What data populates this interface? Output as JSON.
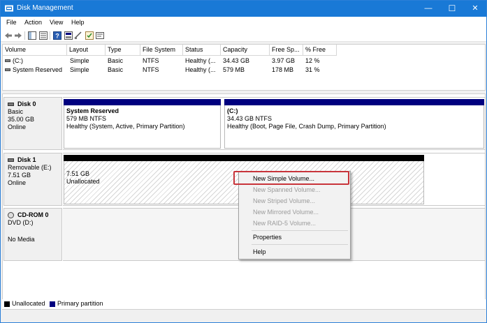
{
  "window": {
    "title": "Disk Management",
    "controls": {
      "minimize": "—",
      "maximize": "☐",
      "close": "✕"
    }
  },
  "menu": [
    "File",
    "Action",
    "View",
    "Help"
  ],
  "toolbar": {
    "icons": [
      "back-arrow-icon",
      "forward-arrow-icon",
      "console-tree-icon",
      "properties-icon",
      "help-icon",
      "disk-view-icon",
      "connect-icon",
      "checklist-icon",
      "disk-settings-icon"
    ]
  },
  "volume_table": {
    "columns": [
      "Volume",
      "Layout",
      "Type",
      "File System",
      "Status",
      "Capacity",
      "Free Sp...",
      "% Free"
    ],
    "rows": [
      [
        "(C:)",
        "Simple",
        "Basic",
        "NTFS",
        "Healthy (...",
        "34.43 GB",
        "3.97 GB",
        "12 %"
      ],
      [
        "System Reserved",
        "Simple",
        "Basic",
        "NTFS",
        "Healthy (...",
        "579 MB",
        "178 MB",
        "31 %"
      ]
    ]
  },
  "disks": {
    "disk0": {
      "name": "Disk 0",
      "type": "Basic",
      "size": "35.00 GB",
      "status": "Online",
      "partitions": [
        {
          "name": "System Reserved",
          "size": "579 MB NTFS",
          "status": "Healthy (System, Active, Primary Partition)"
        },
        {
          "name": "(C:)",
          "size": "34.43 GB NTFS",
          "status": "Healthy (Boot, Page File, Crash Dump, Primary Partition)"
        }
      ]
    },
    "disk1": {
      "name": "Disk 1",
      "type": "Removable (E:)",
      "size": "7.51 GB",
      "status": "Online",
      "unallocated": {
        "size": "7.51 GB",
        "label": "Unallocated"
      }
    },
    "cdrom0": {
      "name": "CD-ROM 0",
      "type": "DVD (D:)",
      "status": "No Media"
    }
  },
  "legend": {
    "unallocated": "Unallocated",
    "primary": "Primary partition",
    "colors": {
      "unallocated": "#000000",
      "primary": "#00007f"
    }
  },
  "context_menu": {
    "items": [
      {
        "label": "New Simple Volume...",
        "enabled": true,
        "highlighted": true
      },
      {
        "label": "New Spanned Volume...",
        "enabled": false
      },
      {
        "label": "New Striped Volume...",
        "enabled": false
      },
      {
        "label": "New Mirrored Volume...",
        "enabled": false
      },
      {
        "label": "New RAID-5 Volume...",
        "enabled": false
      },
      {
        "label": "Properties",
        "enabled": true
      },
      {
        "label": "Help",
        "enabled": true
      }
    ],
    "highlight_color": "#c8343a"
  }
}
